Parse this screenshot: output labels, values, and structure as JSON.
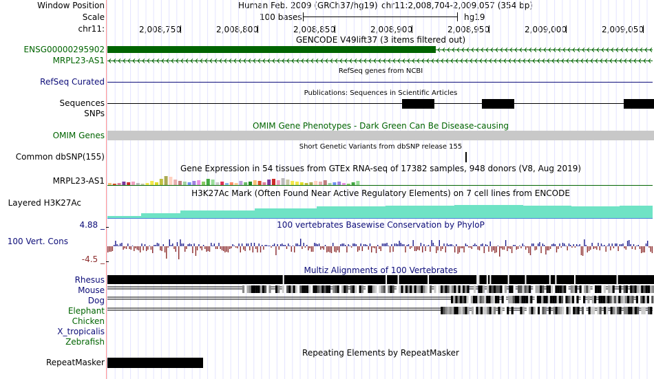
{
  "header": {
    "window_position_label": "Window Position",
    "scale_label": "Scale",
    "chrom_label": "chr11:",
    "assembly": "Human Feb. 2009 (GRCh37/hg19)",
    "position": "chr11:2,008,704-2,009,057 (354 bp)",
    "scale_text": "100 bases",
    "db": "hg19",
    "ticks": [
      "2,008,750",
      "2,008,800",
      "2,008,850",
      "2,008,900",
      "2,008,950",
      "2,009,000",
      "2,009,050"
    ]
  },
  "tracks": {
    "gencode": {
      "title": "GENCODE V49lift37 (3 items filtered out)",
      "items": [
        "ENSG00000295902",
        "MRPL23-AS1"
      ]
    },
    "refseq": {
      "title": "RefSeq genes from NCBI",
      "label": "RefSeq Curated"
    },
    "publications": {
      "title": "Publications: Sequences in Scientific Articles",
      "label": "Sequences"
    },
    "snps_label": "SNPs",
    "omim": {
      "title": "OMIM Gene Phenotypes - Dark Green Can Be Disease-causing",
      "label": "OMIM Genes"
    },
    "dbsnp": {
      "title": "Short Genetic Variants from dbSNP release 155",
      "label": "Common dbSNP(155)"
    },
    "gtex": {
      "title": "Gene Expression in 54 tissues from GTEx RNA-seq of 17382 samples, 948 donors (V8, Aug 2019)",
      "label": "MRPL23-AS1"
    },
    "h3k27ac": {
      "title": "H3K27Ac Mark (Often Found Near Active Regulatory Elements) on 7 cell lines from ENCODE",
      "label": "Layered H3K27Ac"
    },
    "phylop": {
      "title": "100 vertebrates Basewise Conservation by PhyloP",
      "label": "100 Vert. Cons",
      "max": "4.88 _",
      "min": "-4.5 _"
    },
    "multiz": {
      "title": "Multiz Alignments of 100 Vertebrates",
      "species": [
        "Rhesus",
        "Mouse",
        "Dog",
        "Elephant",
        "Chicken",
        "X_tropicalis",
        "Zebrafish"
      ]
    },
    "repeatmasker": {
      "title": "Repeating Elements by RepeatMasker",
      "label": "RepeatMasker"
    }
  },
  "colors": {
    "gencode_dark": "#006400",
    "gencode_label": "#006400",
    "refseq_navy": "#0c0c78",
    "omim_gray": "#c8c8c8",
    "h3k27ac_teal": "#6fe3c5",
    "phylop_pos": "#1c1c8c",
    "phylop_neg": "#8b2a2a",
    "multiz_label": "#0c0c78",
    "guideline": "#e4e4ff",
    "divider_red": "#ff9090"
  }
}
